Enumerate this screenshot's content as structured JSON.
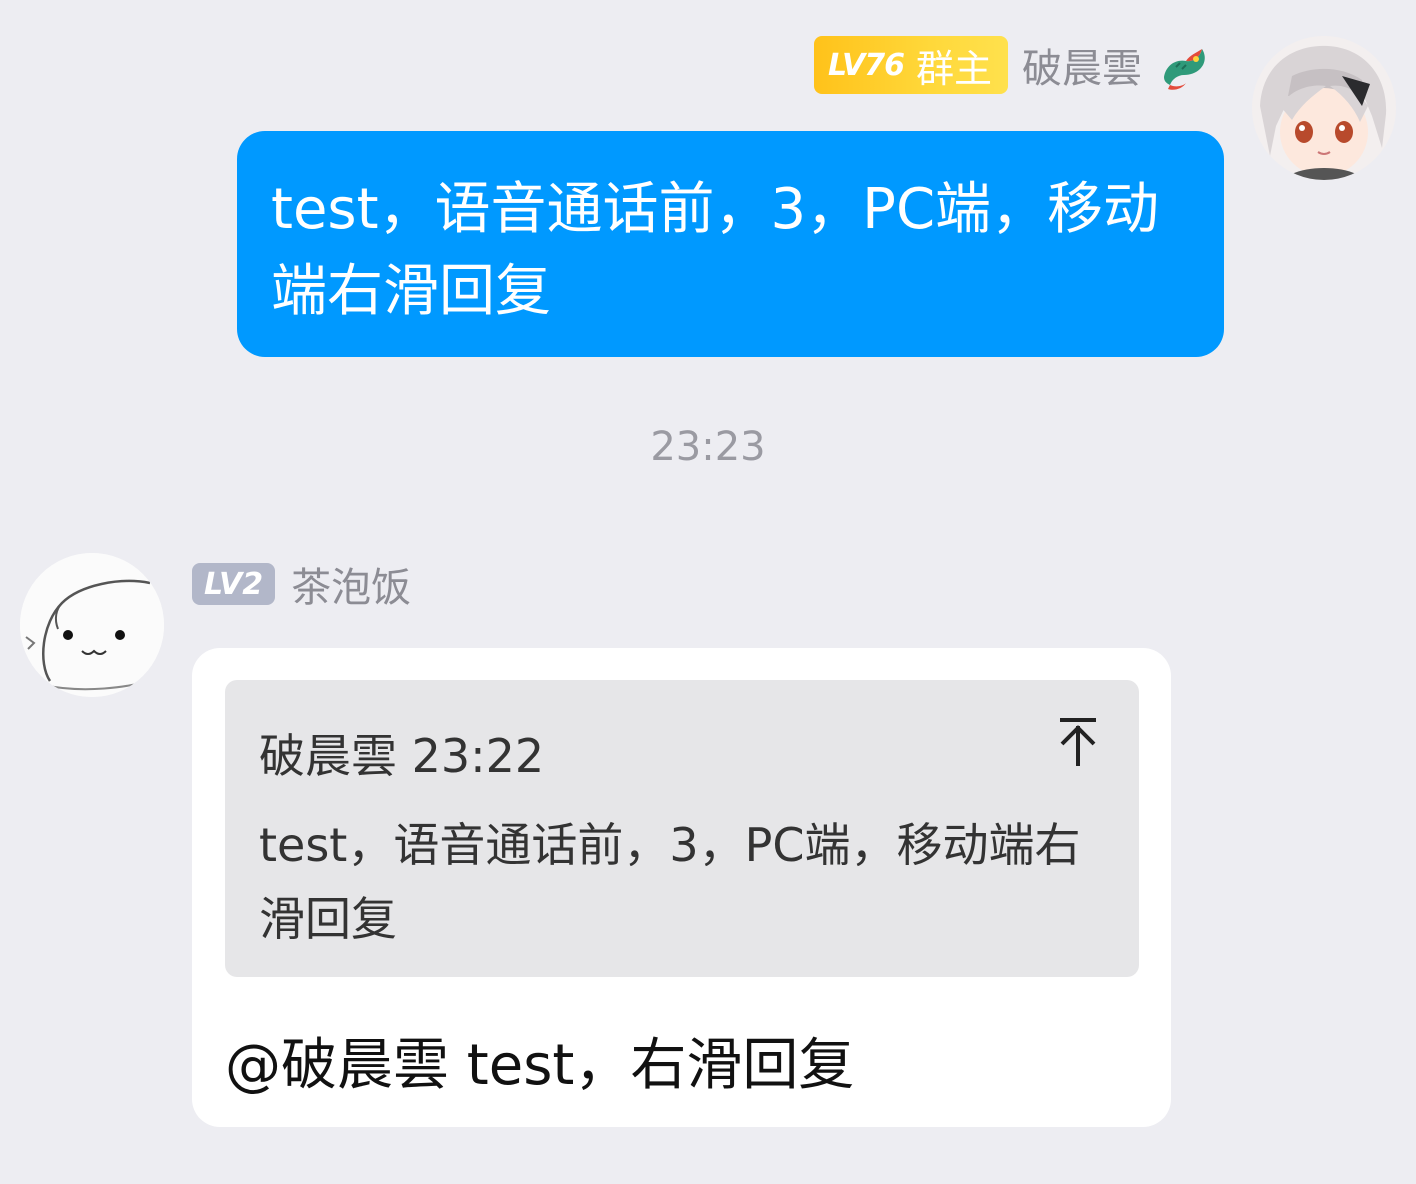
{
  "outgoing": {
    "level_badge": "LV76",
    "role_badge": "群主",
    "sender_name": "破晨雲",
    "title_icon": "dragon-icon",
    "avatar": "anime-avatar",
    "message": "test，语音通话前，3，PC端，移动端右滑回复",
    "colors": {
      "bubble": "#0099ff",
      "role_badge": "#ffc21a"
    }
  },
  "timestamp": "23:23",
  "incoming": {
    "level_badge": "LV2",
    "sender_name": "茶泡饭",
    "avatar": "cute-blob-avatar",
    "quote": {
      "sender": "破晨雲",
      "time": "23:22",
      "text": "test，语音通话前，3，PC端，移动端右滑回复",
      "jump_icon": "scroll-to-top-icon"
    },
    "reply": {
      "mention": "@破晨雲",
      "text": " test，右滑回复"
    },
    "colors": {
      "bubble": "#ffffff",
      "quote_bg": "#e6e6e8",
      "level_badge": "#b2b7c9"
    }
  }
}
